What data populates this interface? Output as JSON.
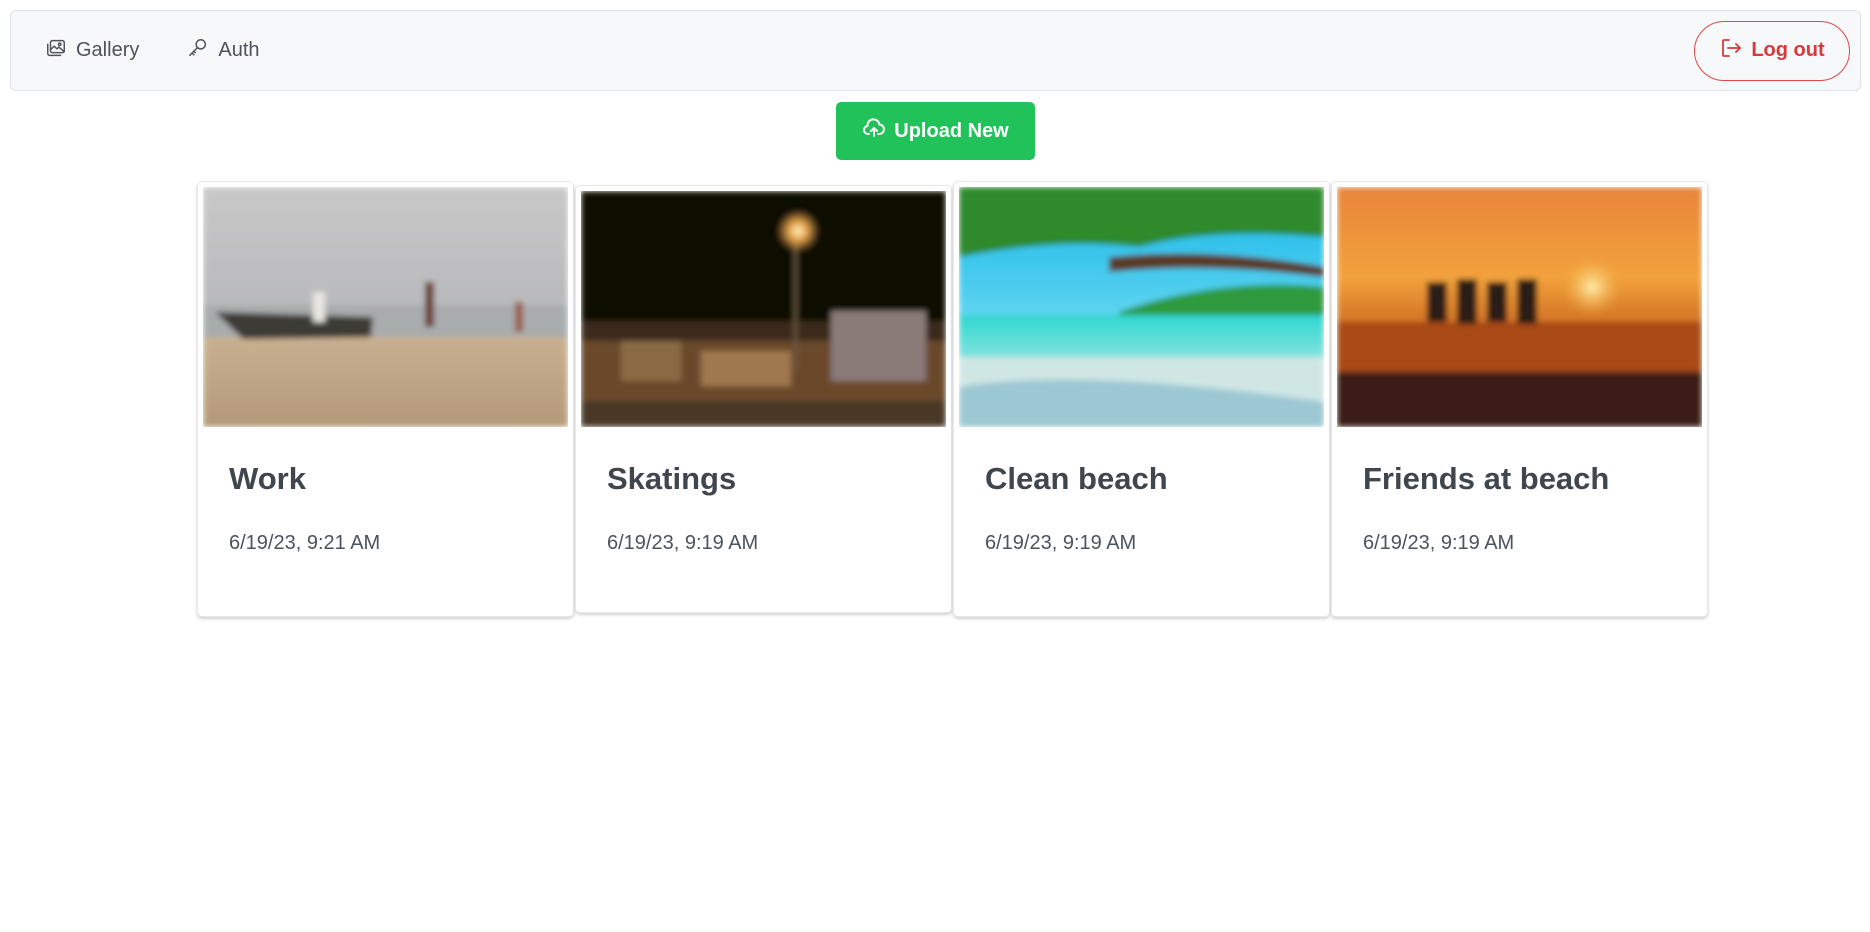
{
  "nav": {
    "gallery_label": "Gallery",
    "auth_label": "Auth",
    "logout_label": "Log out"
  },
  "upload": {
    "label": "Upload New"
  },
  "cards": [
    {
      "title": "Work",
      "date": "6/19/23, 9:21 AM",
      "image": "beach-boat-photo"
    },
    {
      "title": "Skatings",
      "date": "6/19/23, 9:19 AM",
      "image": "night-street-photo"
    },
    {
      "title": "Clean beach",
      "date": "6/19/23, 9:19 AM",
      "image": "tropical-beach-photo"
    },
    {
      "title": "Friends at beach",
      "date": "6/19/23, 9:19 AM",
      "image": "sunset-beach-photo"
    }
  ],
  "colors": {
    "accent_green": "#22c25a",
    "danger_red": "#d8393b",
    "navbar_bg": "#f7f8fa"
  }
}
